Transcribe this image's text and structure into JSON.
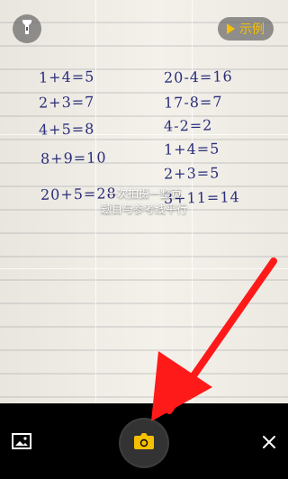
{
  "top": {
    "example_label": "示例"
  },
  "hint": {
    "line1": "一次拍摄一整页",
    "line2": "题目与参考线平行"
  },
  "viewfinder": {
    "left_column": [
      "1+4=5",
      "2+3=7",
      "4+5=8",
      "8+9=10",
      "20+5=28"
    ],
    "right_column": [
      "20-4=16",
      "17-8=7",
      "4-2=2",
      "1+4=5",
      "2+3=5",
      "3+11=14"
    ]
  },
  "colors": {
    "accent": "#f6c000",
    "arrow": "#ff1a1a"
  }
}
